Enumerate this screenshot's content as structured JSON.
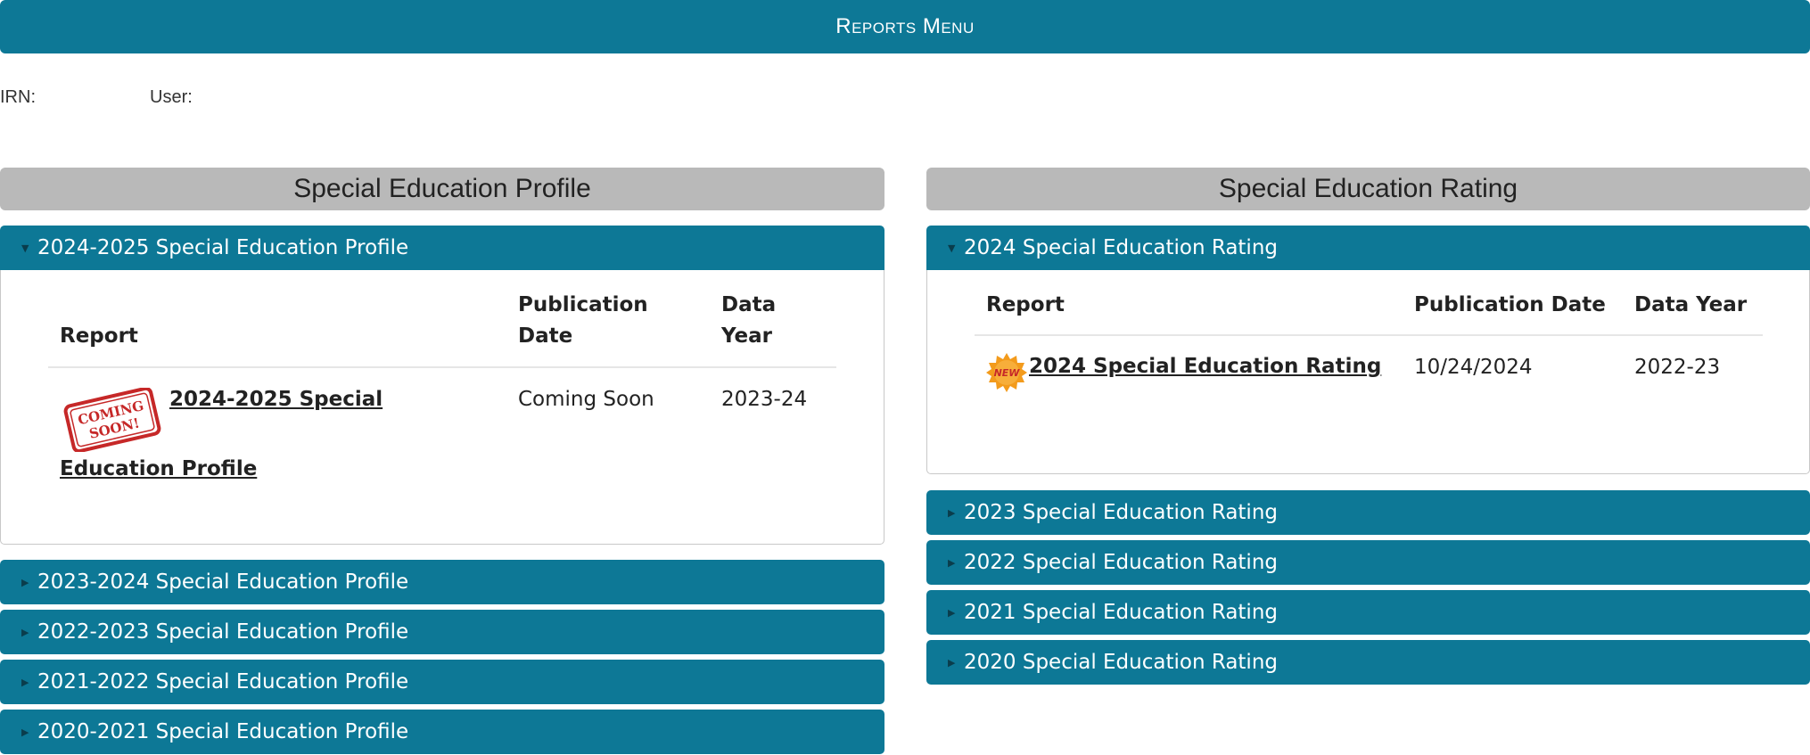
{
  "header": {
    "title": "Reports Menu"
  },
  "meta": {
    "irn_label": "IRN:",
    "user_label": "User:"
  },
  "profile": {
    "heading": "Special Education Profile",
    "open_section": {
      "label": "2024-2025 Special Education Profile",
      "columns": {
        "report": "Report",
        "pub_line1": "Publication",
        "pub_line2": "Date",
        "year_line1": "Data",
        "year_line2": "Year"
      },
      "row": {
        "badge": "COMING SOON!",
        "badge_line1": "COMING",
        "badge_line2": "SOON!",
        "title_line1": "2024-2025 Special",
        "title_line2": "Education Profile",
        "publication_date": "Coming Soon",
        "data_year": "2023-24"
      }
    },
    "collapsed": [
      "2023-2024 Special Education Profile",
      "2022-2023 Special Education Profile",
      "2021-2022 Special Education Profile",
      "2020-2021 Special Education Profile"
    ]
  },
  "rating": {
    "heading": "Special Education Rating",
    "open_section": {
      "label": "2024 Special Education Rating",
      "columns": {
        "report": "Report",
        "pub": "Publication Date",
        "year": "Data Year"
      },
      "row": {
        "badge": "NEW",
        "title": "2024 Special Education Rating",
        "publication_date": "10/24/2024",
        "data_year": "2022-23"
      }
    },
    "collapsed": [
      "2023 Special Education Rating",
      "2022 Special Education Rating",
      "2021 Special Education Rating",
      "2020 Special Education Rating"
    ]
  },
  "colors": {
    "accent": "#0d7896",
    "heading_bg": "#b9b9b9",
    "badge_red": "#c62828",
    "badge_orange": "#f39b1c"
  },
  "icons": {
    "expanded": "triangle-down-icon",
    "collapsed": "triangle-right-icon"
  }
}
